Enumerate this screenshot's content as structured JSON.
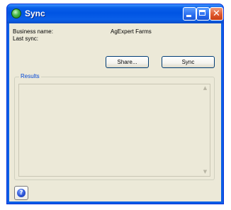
{
  "window": {
    "title": "Sync",
    "close_glyph": "✕"
  },
  "info": {
    "business_name_label": "Business name:",
    "business_name_value": "AgExpert Farms",
    "last_sync_label": "Last sync:"
  },
  "buttons": {
    "share_label": "Share...",
    "sync_label": "Sync"
  },
  "results": {
    "legend": "Results",
    "scroll_up_glyph": "▲",
    "scroll_down_glyph": "▼"
  },
  "help": {
    "glyph": "?"
  },
  "colors": {
    "titlebar": "#0054e3",
    "client_bg": "#ece9d8",
    "legend_text": "#0046d5",
    "close_button": "#e0592f"
  },
  "icons": [
    "app-icon",
    "minimize-icon",
    "maximize-icon",
    "close-icon",
    "help-icon"
  ]
}
